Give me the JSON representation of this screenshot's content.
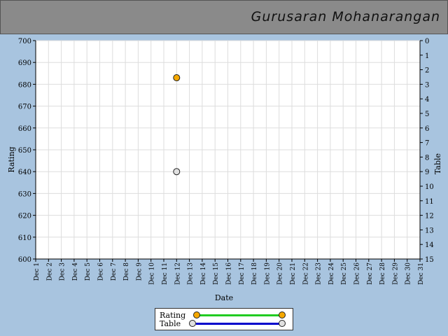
{
  "header": {
    "title": "Gurusaran Mohanarangan"
  },
  "colors": {
    "page_bg": "#a8c4df",
    "plot_bg": "#ffffff",
    "grid": "#dddddd",
    "rating_line": "#22cc22",
    "rating_marker": "#f5a800",
    "table_line": "#0000cc",
    "table_marker": "#e0e0e0"
  },
  "chart_data": {
    "type": "scatter",
    "xlabel": "Date",
    "ylabel": "Rating",
    "y2label": "Table",
    "categories": [
      "Dec 1",
      "Dec 2",
      "Dec 3",
      "Dec 4",
      "Dec 5",
      "Dec 6",
      "Dec 7",
      "Dec 8",
      "Dec 9",
      "Dec 10",
      "Dec 11",
      "Dec 12",
      "Dec 13",
      "Dec 14",
      "Dec 15",
      "Dec 16",
      "Dec 17",
      "Dec 18",
      "Dec 19",
      "Dec 20",
      "Dec 21",
      "Dec 22",
      "Dec 23",
      "Dec 24",
      "Dec 25",
      "Dec 26",
      "Dec 27",
      "Dec 28",
      "Dec 29",
      "Dec 30",
      "Dec 31"
    ],
    "ylim": [
      600,
      700
    ],
    "yticks": [
      600,
      610,
      620,
      630,
      640,
      650,
      660,
      670,
      680,
      690,
      700
    ],
    "y2lim": [
      0,
      15
    ],
    "y2_inverted": true,
    "y2ticks": [
      0,
      1,
      2,
      3,
      4,
      5,
      6,
      7,
      8,
      9,
      10,
      11,
      12,
      13,
      14,
      15
    ],
    "grid": true,
    "legend_position": "bottom-center",
    "series": [
      {
        "name": "Rating",
        "axis": "left",
        "points": [
          {
            "x": "Dec 12",
            "y": 683
          }
        ]
      },
      {
        "name": "Table",
        "axis": "right",
        "points": [
          {
            "x": "Dec 12",
            "y": 9
          }
        ]
      }
    ]
  }
}
